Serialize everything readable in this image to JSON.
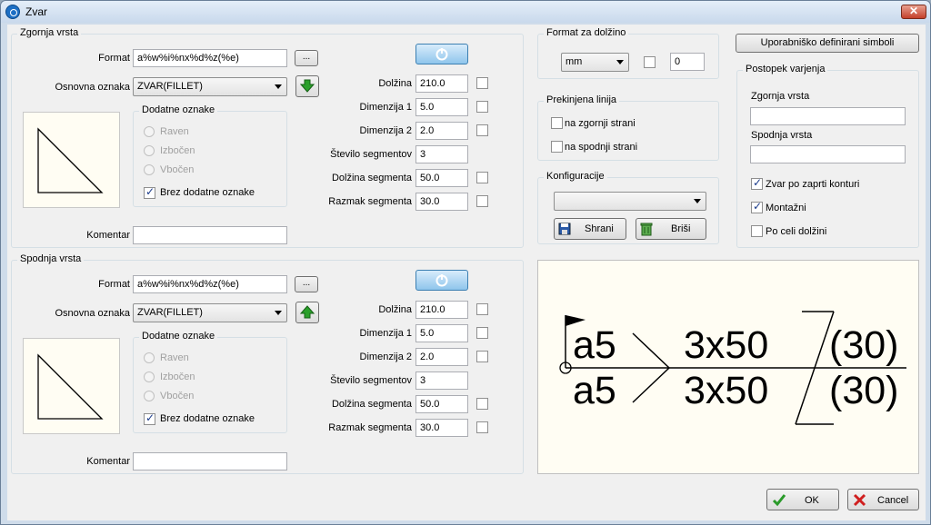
{
  "window": {
    "title": "Zvar",
    "close_label": "✕"
  },
  "top": {
    "group_title": "Zgornja vrsta",
    "format_label": "Format",
    "format_value": "a%w%i%nx%d%z(%e)",
    "browse_label": "...",
    "base_label": "Osnovna oznaka",
    "base_value": "ZVAR(FILLET)",
    "extra_title": "Dodatne oznake",
    "radios": [
      "Raven",
      "Izbočen",
      "Vbočen"
    ],
    "no_extra_label": "Brez dodatne oznake",
    "comment_label": "Komentar",
    "comment_value": "",
    "fields": [
      {
        "label": "Dolžina",
        "value": "210.0",
        "has_check": true
      },
      {
        "label": "Dimenzija 1",
        "value": "5.0",
        "has_check": true
      },
      {
        "label": "Dimenzija 2",
        "value": "2.0",
        "has_check": true
      },
      {
        "label": "Število segmentov",
        "value": "3",
        "has_check": false
      },
      {
        "label": "Dolžina segmenta",
        "value": "50.0",
        "has_check": true
      },
      {
        "label": "Razmak segmenta",
        "value": "30.0",
        "has_check": true
      }
    ]
  },
  "bottom": {
    "group_title": "Spodnja vrsta",
    "format_label": "Format",
    "format_value": "a%w%i%nx%d%z(%e)",
    "browse_label": "...",
    "base_label": "Osnovna oznaka",
    "base_value": "ZVAR(FILLET)",
    "extra_title": "Dodatne oznake",
    "radios": [
      "Raven",
      "Izbočen",
      "Vbočen"
    ],
    "no_extra_label": "Brez dodatne oznake",
    "comment_label": "Komentar",
    "comment_value": "",
    "fields": [
      {
        "label": "Dolžina",
        "value": "210.0",
        "has_check": true
      },
      {
        "label": "Dimenzija 1",
        "value": "5.0",
        "has_check": true
      },
      {
        "label": "Dimenzija 2",
        "value": "2.0",
        "has_check": true
      },
      {
        "label": "Število segmentov",
        "value": "3",
        "has_check": false
      },
      {
        "label": "Dolžina segmenta",
        "value": "50.0",
        "has_check": true
      },
      {
        "label": "Razmak segmenta",
        "value": "30.0",
        "has_check": true
      }
    ]
  },
  "length_format": {
    "title": "Format za dolžino",
    "unit": "mm",
    "value": "0"
  },
  "broken_line": {
    "title": "Prekinjena linija",
    "opt1": "na zgornji strani",
    "opt2": "na spodnji strani"
  },
  "config": {
    "title": "Konfiguracije",
    "selected": "",
    "save_label": "Shrani",
    "delete_label": "Briši"
  },
  "user_symbols_label": "Uporabniško definirani simboli",
  "procedure": {
    "title": "Postopek varjenja",
    "top_label": "Zgornja vrsta",
    "top_value": "",
    "bottom_label": "Spodnja vrsta",
    "bottom_value": "",
    "closed_contour": "Zvar po zaprti konturi",
    "assembly": "Montažni",
    "full_length": "Po celi dolžini"
  },
  "preview": {
    "top_a": "a5",
    "top_seg": "3x50",
    "top_gap": "(30)",
    "bot_a": "a5",
    "bot_seg": "3x50",
    "bot_gap": "(30)"
  },
  "footer": {
    "ok_label": "OK",
    "cancel_label": "Cancel"
  }
}
